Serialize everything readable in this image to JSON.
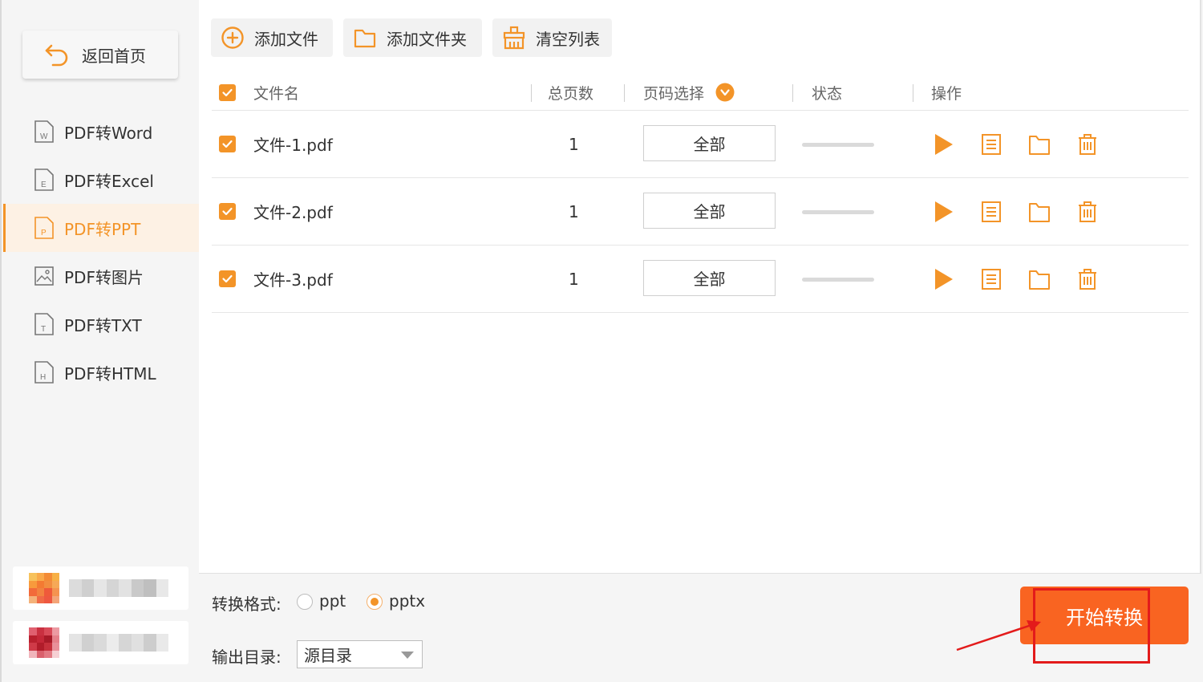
{
  "sidebar": {
    "back_label": "返回首页",
    "items": [
      {
        "label": "PDF转Word",
        "icon": "W"
      },
      {
        "label": "PDF转Excel",
        "icon": "E"
      },
      {
        "label": "PDF转PPT",
        "icon": "P"
      },
      {
        "label": "PDF转图片",
        "icon": "image"
      },
      {
        "label": "PDF转TXT",
        "icon": "T"
      },
      {
        "label": "PDF转HTML",
        "icon": "H"
      }
    ],
    "active_item": "PDF转PPT"
  },
  "toolbar": {
    "add_file_label": "添加文件",
    "add_folder_label": "添加文件夹",
    "clear_list_label": "清空列表"
  },
  "table": {
    "headers": {
      "filename": "文件名",
      "total_pages": "总页数",
      "page_select": "页码选择",
      "status": "状态",
      "actions": "操作"
    },
    "rows": [
      {
        "filename": "文件-1.pdf",
        "pages": "1",
        "page_select": "全部",
        "checked": true,
        "progress": 0
      },
      {
        "filename": "文件-2.pdf",
        "pages": "1",
        "page_select": "全部",
        "checked": true,
        "progress": 0
      },
      {
        "filename": "文件-3.pdf",
        "pages": "1",
        "page_select": "全部",
        "checked": true,
        "progress": 0
      }
    ]
  },
  "footer": {
    "format_label": "转换格式:",
    "format_options": [
      "ppt",
      "pptx"
    ],
    "format_selected": "pptx",
    "output_label": "输出目录:",
    "output_value": "源目录",
    "start_label": "开始转换"
  },
  "colors": {
    "accent": "#f39428",
    "start_button": "#f96421",
    "annotation": "#e31b1b"
  }
}
